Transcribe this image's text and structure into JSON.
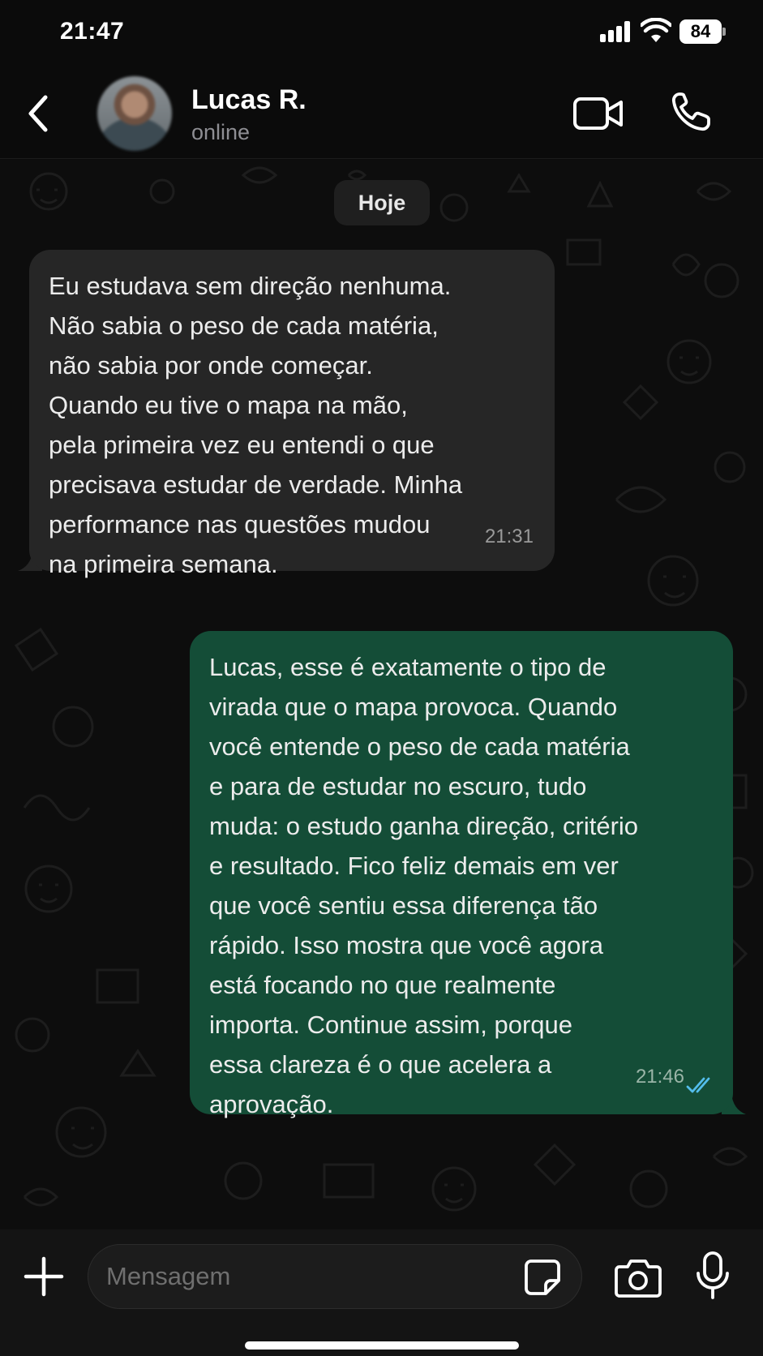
{
  "status_bar": {
    "time": "21:47",
    "battery": "84"
  },
  "header": {
    "contact_name": "Lucas R.",
    "contact_status": "online"
  },
  "chat": {
    "date_label": "Hoje",
    "messages": [
      {
        "direction": "incoming",
        "lines": [
          "Eu estudava sem direção nenhuma.",
          "Não sabia o peso de cada matéria,",
          "não sabia por onde começar.",
          "Quando eu tive o mapa na mão,",
          "pela primeira vez eu entendi o que",
          "precisava estudar de verdade. Minha",
          "performance nas questões mudou",
          "na primeira semana."
        ],
        "time": "21:31"
      },
      {
        "direction": "outgoing",
        "lines": [
          "Lucas, esse é exatamente o tipo de",
          "virada que o mapa provoca. Quando",
          "você entende o peso de cada matéria",
          "e para de estudar no escuro, tudo",
          "muda: o estudo ganha direção, critério",
          "e resultado. Fico feliz demais em ver",
          "que você sentiu essa diferença tão",
          "rápido. Isso mostra que você agora",
          "está focando no que realmente",
          "importa. Continue assim, porque",
          "essa clareza é o que acelera a",
          "aprovação."
        ],
        "time": "21:46",
        "read_status": "read"
      }
    ]
  },
  "input_bar": {
    "placeholder": "Mensagem"
  },
  "colors": {
    "incoming_bubble": "#262626",
    "outgoing_bubble": "#144d37",
    "read_ticks": "#53bdeb",
    "background": "#0b0b0b"
  },
  "icons": [
    "back-arrow-icon",
    "video-camera-icon",
    "phone-icon",
    "plus-icon",
    "sticker-icon",
    "camera-icon",
    "microphone-icon",
    "double-check-icon"
  ]
}
